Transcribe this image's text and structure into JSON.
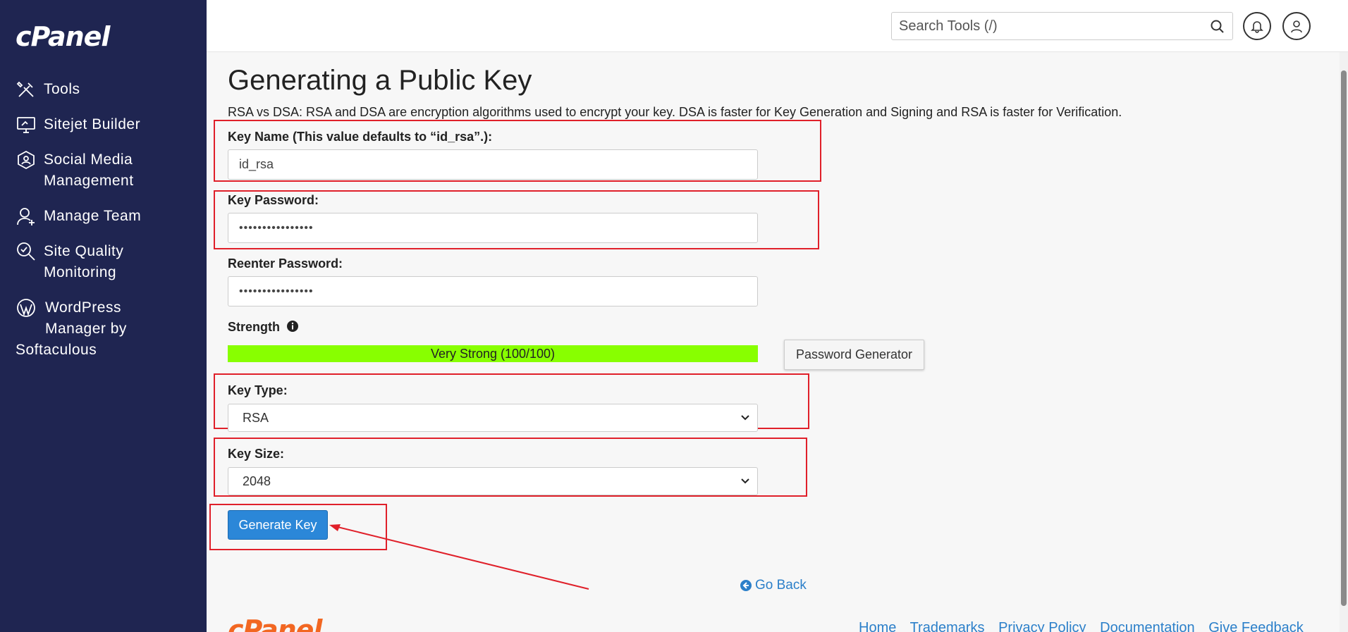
{
  "sidebar": {
    "logo": "cPanel",
    "items": [
      {
        "icon": "tools-icon",
        "label": "Tools"
      },
      {
        "icon": "monitor-icon",
        "label": "Sitejet Builder"
      },
      {
        "icon": "social-icon",
        "label_line1": "Social Media",
        "label_line2": "Management"
      },
      {
        "icon": "team-icon",
        "label": "Manage Team"
      },
      {
        "icon": "search-quality-icon",
        "label_line1": "Site Quality",
        "label_line2": "Monitoring"
      },
      {
        "icon": "wordpress-icon",
        "label_line1": "WordPress",
        "label_line2": "Manager by",
        "label_line3": "Softaculous"
      }
    ]
  },
  "header": {
    "search_placeholder": "Search Tools (/)"
  },
  "page": {
    "title": "Generating a Public Key",
    "description": "RSA vs DSA: RSA and DSA are encryption algorithms used to encrypt your key. DSA is faster for Key Generation and Signing and RSA is faster for Verification.",
    "key_name_label": "Key Name (This value defaults to “id_rsa”.):",
    "key_name_value": "id_rsa",
    "key_password_label": "Key Password:",
    "key_password_value": "••••••••••••••••",
    "reenter_password_label": "Reenter Password:",
    "reenter_password_value": "••••••••••••••••",
    "strength_label": "Strength",
    "strength_text": "Very Strong (100/100)",
    "strength_percent": 100,
    "password_generator_label": "Password Generator",
    "key_type_label": "Key Type:",
    "key_type_value": "RSA",
    "key_size_label": "Key Size:",
    "key_size_value": "2048",
    "generate_button": "Generate Key",
    "go_back": "Go Back"
  },
  "footer": {
    "logo": "cPanel",
    "links": [
      "Home",
      "Trademarks",
      "Privacy Policy",
      "Documentation",
      "Give Feedback"
    ]
  },
  "colors": {
    "sidebar_bg": "#1f2551",
    "strength_bar": "#88ff00",
    "primary_button": "#2b87d8",
    "annotation_red": "#e0202a",
    "link": "#2b7fc9",
    "footer_logo": "#f26722"
  }
}
